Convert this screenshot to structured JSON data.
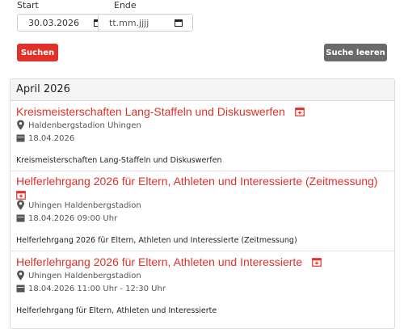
{
  "filter": {
    "start_label": "Start",
    "end_label": "Ende",
    "start_value": "30.03.2026",
    "end_placeholder": "tt.mm.jjjj",
    "search_button": "Suchen",
    "clear_button": "Suche leeren",
    "search_button_color": "#e0312b",
    "clear_button_color": "#6a6a6a"
  },
  "month_panel": {
    "heading": "April 2026",
    "events": [
      {
        "title": "Kreismeisterschaften Lang-Staffeln und Diskuswerfen",
        "location": "Haldenbergstadion Uhingen",
        "date": "18.04.2026",
        "description": "Kreismeisterschaften Lang-Staffeln und Diskuswerfen"
      },
      {
        "title": "Helferlehrgang 2026 für Eltern, Athleten und Interessierte (Zeitmessung)",
        "location": "Uhingen Haldenbergstadion",
        "date": "18.04.2026 09:00 Uhr",
        "description": "Helferlehrgang 2026 für Eltern, Athleten und Interessierte (Zeitmessung)"
      },
      {
        "title": "Helferlehrgang 2026 für Eltern, Athleten und Interessierte",
        "location": "Uhingen Haldenbergstadion",
        "date": "18.04.2026 11:00 Uhr - 12:30 Uhr",
        "description": "Helferlehrgang für Eltern, Athleten und Interessierte"
      }
    ]
  },
  "accent_color": "#e0312b"
}
